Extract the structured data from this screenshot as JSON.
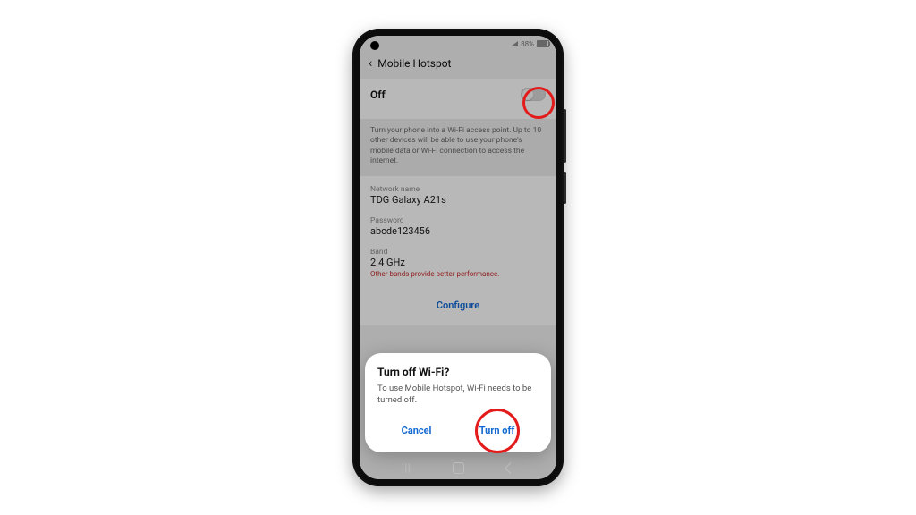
{
  "statusbar": {
    "battery_text": "88%"
  },
  "header": {
    "title": "Mobile Hotspot"
  },
  "main": {
    "state_label": "Off",
    "description": "Turn your phone into a Wi-Fi access point. Up to 10 other devices will be able to use your phone's mobile data or Wi-Fi connection to access the internet.",
    "network_name_label": "Network name",
    "network_name_value": "TDG Galaxy A21s",
    "password_label": "Password",
    "password_value": "abcde123456",
    "band_label": "Band",
    "band_value": "2.4 GHz",
    "band_warning": "Other bands provide better performance.",
    "configure_label": "Configure"
  },
  "dialog": {
    "title": "Turn off Wi-Fi?",
    "body": "To use Mobile Hotspot, Wi-Fi needs to be turned off.",
    "cancel_label": "Cancel",
    "confirm_label": "Turn off"
  }
}
